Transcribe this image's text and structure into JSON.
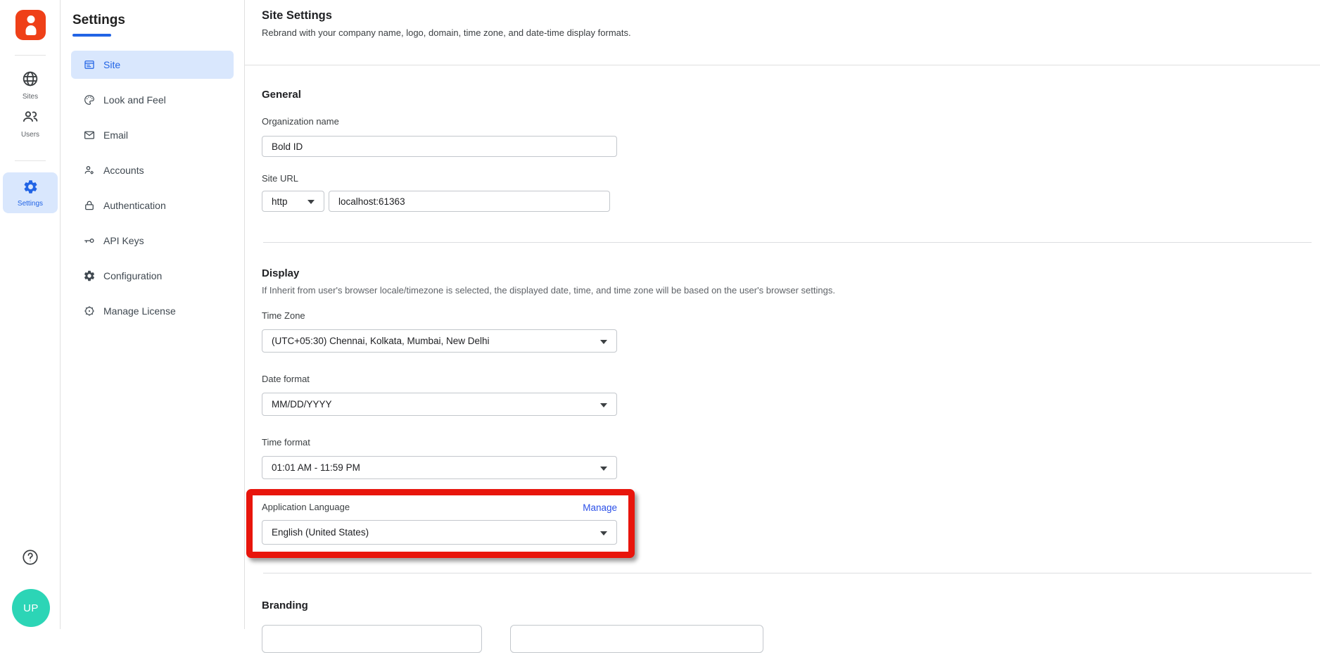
{
  "colors": {
    "accent_blue": "#2264e5",
    "link_blue": "#2b50e8",
    "selected_bg": "#d9e7fd",
    "logo_orange": "#ef4018",
    "avatar_teal": "#2cd5b6",
    "highlight_red": "#e8150c"
  },
  "rail": {
    "items": [
      {
        "icon": "globe-icon",
        "label": "Sites"
      },
      {
        "icon": "users-icon",
        "label": "Users"
      },
      {
        "icon": "gear-icon",
        "label": "Settings"
      }
    ],
    "avatar_initials": "UP"
  },
  "sidebar": {
    "title": "Settings",
    "items": [
      {
        "icon": "site-icon",
        "label": "Site"
      },
      {
        "icon": "palette-icon",
        "label": "Look and Feel"
      },
      {
        "icon": "email-icon",
        "label": "Email"
      },
      {
        "icon": "accounts-icon",
        "label": "Accounts"
      },
      {
        "icon": "lock-icon",
        "label": "Authentication"
      },
      {
        "icon": "key-icon",
        "label": "API Keys"
      },
      {
        "icon": "gear-icon",
        "label": "Configuration"
      },
      {
        "icon": "license-icon",
        "label": "Manage License"
      }
    ]
  },
  "header": {
    "title": "Site Settings",
    "subtitle": "Rebrand with your company name, logo, domain, time zone, and date-time display formats."
  },
  "general": {
    "heading": "General",
    "org_label": "Organization name",
    "org_value": "Bold ID",
    "url_label": "Site URL",
    "protocol_value": "http",
    "url_value": "localhost:61363"
  },
  "display": {
    "heading": "Display",
    "description": "If Inherit from user's browser locale/timezone is selected, the displayed date, time, and time zone will be based on the user's browser settings.",
    "timezone_label": "Time Zone",
    "timezone_value": "(UTC+05:30) Chennai, Kolkata, Mumbai, New Delhi",
    "dateformat_label": "Date format",
    "dateformat_value": "MM/DD/YYYY",
    "timeformat_label": "Time format",
    "timeformat_value": "01:01 AM - 11:59 PM",
    "language_label": "Application Language",
    "language_value": "English (United States)",
    "manage_label": "Manage"
  },
  "branding": {
    "heading": "Branding"
  }
}
